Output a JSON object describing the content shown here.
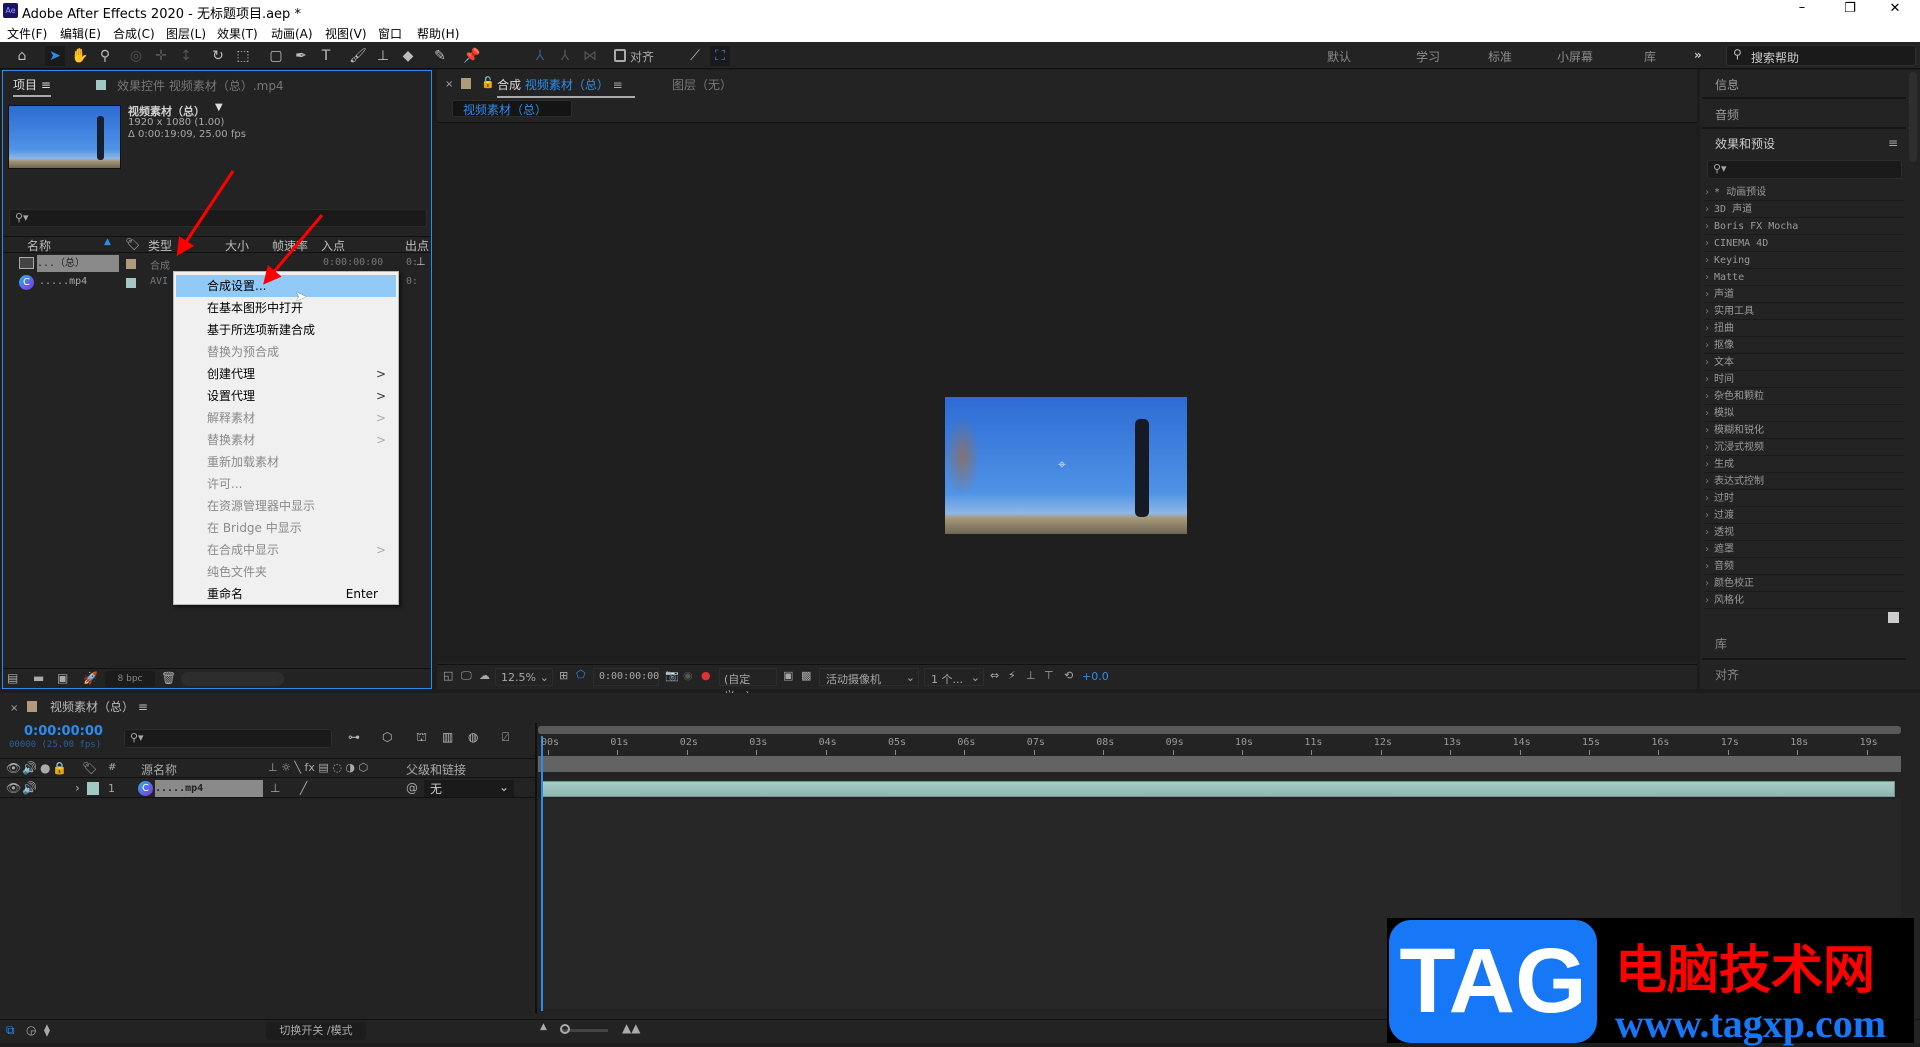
{
  "window": {
    "title": "Adobe After Effects 2020 - 无标题项目.aep *",
    "app_icon": "Ae"
  },
  "menu": [
    "文件(F)",
    "编辑(E)",
    "合成(C)",
    "图层(L)",
    "效果(T)",
    "动画(A)",
    "视图(V)",
    "窗口",
    "帮助(H)"
  ],
  "toolbar": {
    "snap_label": "对齐",
    "workspaces": [
      "默认",
      "学习",
      "标准",
      "小屏幕",
      "库"
    ],
    "more": "»",
    "search_placeholder": "搜索帮助"
  },
  "project": {
    "tab": "项目",
    "effects_tab": "效果控件 视频素材（总）.mp4",
    "item_name": "视频素材（总）",
    "item_dims": "1920 x 1080 (1.00)",
    "item_duration": "Δ 0:00:19:09, 25.00 fps",
    "columns": [
      "名称",
      "类型",
      "大小",
      "帧速率",
      "入点",
      "出点"
    ],
    "rows": [
      {
        "name": "...（总）",
        "type": "合成",
        "in": "0:00:00:00",
        "out": "0:",
        "color": "#b09a7c"
      },
      {
        "name": ".....mp4",
        "type": "AVI",
        "in": "",
        "out": "0:",
        "color": "#a3c7c4"
      }
    ],
    "bpc": "8 bpc"
  },
  "context_menu": [
    {
      "label": "合成设置...",
      "state": "highlighted"
    },
    {
      "label": "在基本图形中打开",
      "state": "enabled"
    },
    {
      "label": "基于所选项新建合成",
      "state": "enabled"
    },
    {
      "label": "替换为预合成",
      "state": "disabled"
    },
    {
      "label": "创建代理",
      "state": "enabled",
      "submenu": ">"
    },
    {
      "label": "设置代理",
      "state": "enabled",
      "submenu": ">"
    },
    {
      "label": "解释素材",
      "state": "disabled",
      "submenu": ">"
    },
    {
      "label": "替换素材",
      "state": "disabled",
      "submenu": ">"
    },
    {
      "label": "重新加载素材",
      "state": "disabled"
    },
    {
      "label": "许可...",
      "state": "disabled"
    },
    {
      "label": "在资源管理器中显示",
      "state": "disabled"
    },
    {
      "label": "在 Bridge 中显示",
      "state": "disabled"
    },
    {
      "label": "在合成中显示",
      "state": "disabled",
      "submenu": ">"
    },
    {
      "label": "纯色文件夹",
      "state": "disabled"
    },
    {
      "label": "重命名",
      "state": "enabled",
      "shortcut": "Enter"
    }
  ],
  "composition": {
    "tab_prefix": "合成",
    "tab_name": "视频素材（总）",
    "layer_tab": "图层（无）",
    "breadcrumb": "视频素材（总）",
    "zoom": "12.5%",
    "timecode": "0:00:00:00",
    "resolution": "(自定义...)",
    "camera": "活动摄像机",
    "views": "1 个...",
    "exposure": "+0.0"
  },
  "right_panel": {
    "info": "信息",
    "audio": "音频",
    "effects": "效果和预设",
    "library": "库",
    "align": "对齐",
    "effects_list": [
      "* 动画预设",
      "3D 声道",
      "Boris FX Mocha",
      "CINEMA 4D",
      "Keying",
      "Matte",
      "声道",
      "实用工具",
      "扭曲",
      "抠像",
      "文本",
      "时间",
      "杂色和颗粒",
      "模拟",
      "模糊和锐化",
      "沉浸式视频",
      "生成",
      "表达式控制",
      "过时",
      "过渡",
      "透视",
      "遮罩",
      "音频",
      "颜色校正",
      "风格化"
    ]
  },
  "timeline": {
    "tab": "视频素材（总）",
    "timecode": "0:00:00:00",
    "frames": "00000 (25.00 fps)",
    "col_source": "源名称",
    "col_parent": "父级和链接",
    "col_hash": "#",
    "layer": {
      "index": "1",
      "name": ".....mp4",
      "parent": "无"
    },
    "ticks": [
      "00s",
      "01s",
      "02s",
      "03s",
      "04s",
      "05s",
      "06s",
      "07s",
      "08s",
      "09s",
      "10s",
      "11s",
      "12s",
      "13s",
      "14s",
      "15s",
      "16s",
      "17s",
      "18s",
      "19s"
    ],
    "toggle_label": "切换开关 /模式"
  },
  "watermark": {
    "logo": "TAG",
    "site_name": "电脑技术网",
    "url": "www.tagxp.com"
  },
  "colors": {
    "accent": "#2d8ceb",
    "highlight": "#91c9f7",
    "clip": "#9fc4bf"
  }
}
